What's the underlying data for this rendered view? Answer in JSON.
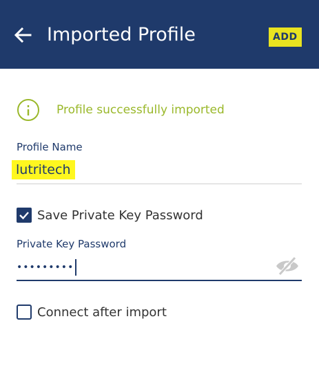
{
  "appbar": {
    "title": "Imported Profile",
    "add_label": "ADD",
    "background": "#1f3a6b",
    "add_highlight": "#e9e320"
  },
  "status": {
    "message": "Profile successfully imported",
    "color": "#9ab82a",
    "icon": "info-icon"
  },
  "profile_name": {
    "label": "Profile Name",
    "value": "lutritech",
    "highlight": "#fff71f"
  },
  "save_password": {
    "label": "Save Private Key Password",
    "checked": true
  },
  "private_key_password": {
    "label": "Private Key Password",
    "masked_value": "•••••••••",
    "visibility_icon": "eye-off-icon"
  },
  "connect_after_import": {
    "label": "Connect after import",
    "checked": false
  }
}
